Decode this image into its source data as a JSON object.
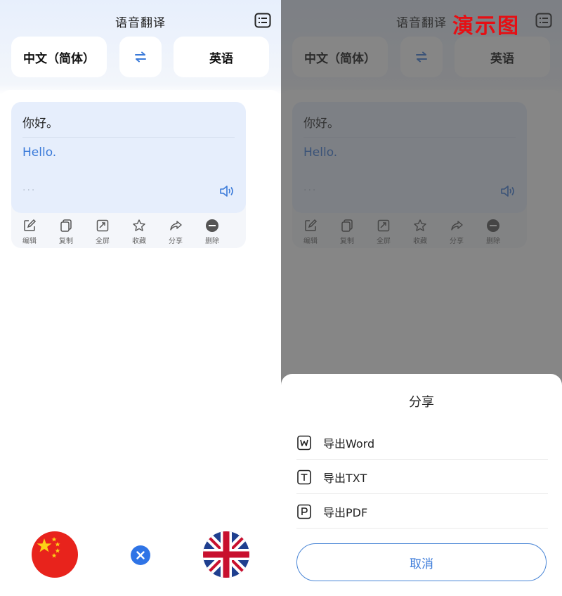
{
  "app": {
    "title": "语音翻译"
  },
  "languages": {
    "source": "中文（简体）",
    "target": "英语",
    "swap_icon": "swap-arrows-icon"
  },
  "card": {
    "source_text": "你好。",
    "translated_text": "Hello.",
    "more": "···",
    "toolbar": [
      {
        "label": "编辑",
        "icon": "edit-icon"
      },
      {
        "label": "复制",
        "icon": "copy-icon"
      },
      {
        "label": "全屏",
        "icon": "fullscreen-icon"
      },
      {
        "label": "收藏",
        "icon": "star-icon"
      },
      {
        "label": "分享",
        "icon": "share-icon"
      },
      {
        "label": "删除",
        "icon": "delete-icon"
      }
    ]
  },
  "watermark": "演示图",
  "share_sheet": {
    "title": "分享",
    "items": [
      {
        "label": "导出Word",
        "icon": "word-file-icon"
      },
      {
        "label": "导出TXT",
        "icon": "txt-file-icon"
      },
      {
        "label": "导出PDF",
        "icon": "pdf-file-icon"
      }
    ],
    "cancel": "取消"
  },
  "colors": {
    "accent": "#3a7ad9",
    "watermark": "#e60f14",
    "close": "#2f74e6"
  }
}
